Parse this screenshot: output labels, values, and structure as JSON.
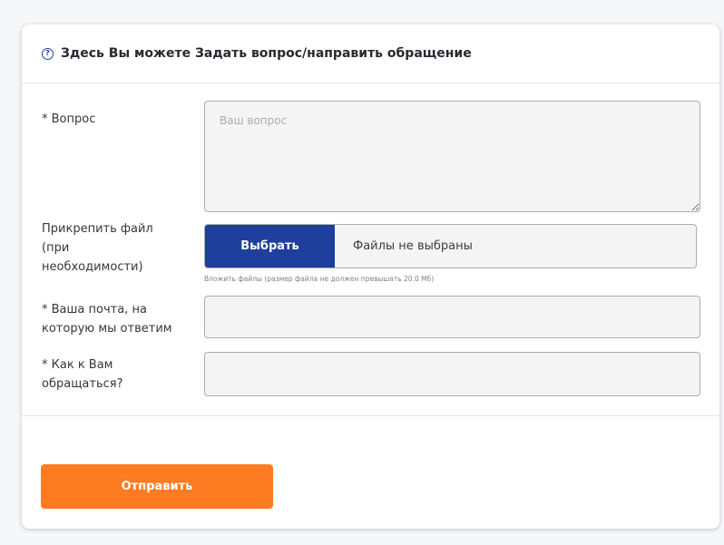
{
  "header": {
    "icon": "question-circle-icon",
    "icon_glyph": "?",
    "title": "Здесь Вы можете Задать вопрос/направить обращение"
  },
  "form": {
    "question": {
      "label": "* Вопрос",
      "placeholder": "Ваш вопрос",
      "value": ""
    },
    "attachment": {
      "label": "Прикрепить файл (при необходимости)",
      "button_label": "Выбрать",
      "status_text": "Файлы не выбраны",
      "hint": "Вложить файлы (размер файла не должен превышать 20.0 Мб)"
    },
    "email": {
      "label": "* Ваша почта, на которую мы ответим",
      "value": ""
    },
    "name": {
      "label": "* Как к Вам обращаться?",
      "value": ""
    }
  },
  "actions": {
    "submit_label": "Отправить"
  },
  "colors": {
    "primary": "#1e3f9c",
    "submit": "#fd7b21",
    "field_bg": "#f4f4f5",
    "field_border": "#a8acb2"
  }
}
